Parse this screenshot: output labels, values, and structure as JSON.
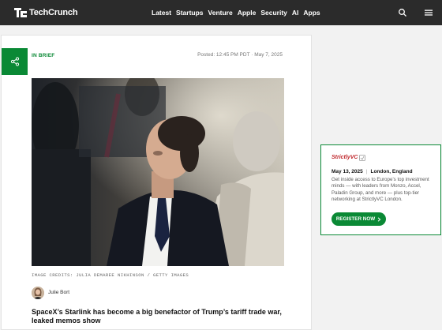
{
  "header": {
    "logo_text": "TechCrunch",
    "nav": [
      "Latest",
      "Startups",
      "Venture",
      "Apple",
      "Security",
      "AI",
      "Apps"
    ],
    "icons": [
      "search-icon",
      "menu-icon"
    ]
  },
  "article": {
    "category": "IN BRIEF",
    "posted": "Posted: 12:45 PM PDT · May 7, 2025",
    "image_credits": "IMAGE CREDITS: JULIA DEMAREE NIKHINSON / GETTY IMAGES",
    "author": "Julie Bort",
    "headline": "SpaceX’s Starlink has become a big benefactor of Trump’s tariff trade war, leaked memos show",
    "share_icon": "share-icon"
  },
  "ad": {
    "brand": "StrictlyVC",
    "date": "May 13, 2025",
    "location": "London, England",
    "body": "Get inside access to Europe’s top investment minds — with leaders from Monzo, Accel, Paladin Group, and more — plus top-tier networking at StrictlyVC London.",
    "cta": "REGISTER NOW",
    "cta_icon": "chevron-right-icon"
  },
  "colors": {
    "header_bg": "#2b2b2b",
    "accent_green": "#0a8935",
    "brand_red": "#c0282d"
  }
}
